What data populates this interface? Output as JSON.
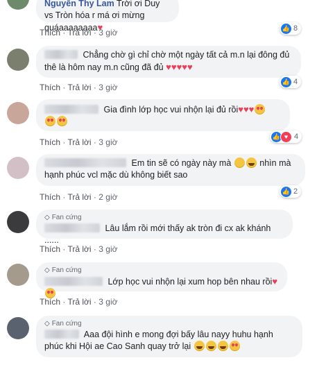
{
  "actions": {
    "like": "Thích",
    "reply": "Trả lời",
    "sep": "·"
  },
  "comments": [
    {
      "name": "Nguyễn Thy Lam",
      "text": "Trời ơi Duy vs Tròn hóa r má ơi mừng quáaaaaaaaa",
      "time": "3 giờ",
      "reactions": "8"
    },
    {
      "name": "",
      "text": "Chẳng chờ gì chỉ chờ một ngày tất cả m.n lại đông đủ thê là hôm nay m.n cũng đã đủ",
      "time": "3 giờ",
      "reactions": "4"
    },
    {
      "name": "",
      "text": "Gia đình lớp học vui nhộn lại đủ rồi",
      "time": "3 giờ",
      "reactions": "4"
    },
    {
      "name": "",
      "text_1": "Em tin sẽ có ngày này mà",
      "text_2": "nhìn mà hạnh phúc vcl mặc dù không biết sao",
      "time": "2 giờ",
      "reactions": "2"
    },
    {
      "badge": "Fan cứng",
      "name": "",
      "text": "Lâu lắm rồi mới thấy ak tròn đi cx ak khánh ......",
      "time": "3 giờ"
    },
    {
      "badge": "Fan cứng",
      "name": "",
      "text": "Lớp học vui nhộn lại xum hop bên nhau rồi",
      "time": "3 giờ"
    },
    {
      "badge": "Fan cứng",
      "name": "",
      "text": "Aaa đội hình e mong đợi bấy lâu nayy huhu hạnh phúc khi Hội ae Cao Sanh quay trở lại",
      "time": ""
    }
  ]
}
